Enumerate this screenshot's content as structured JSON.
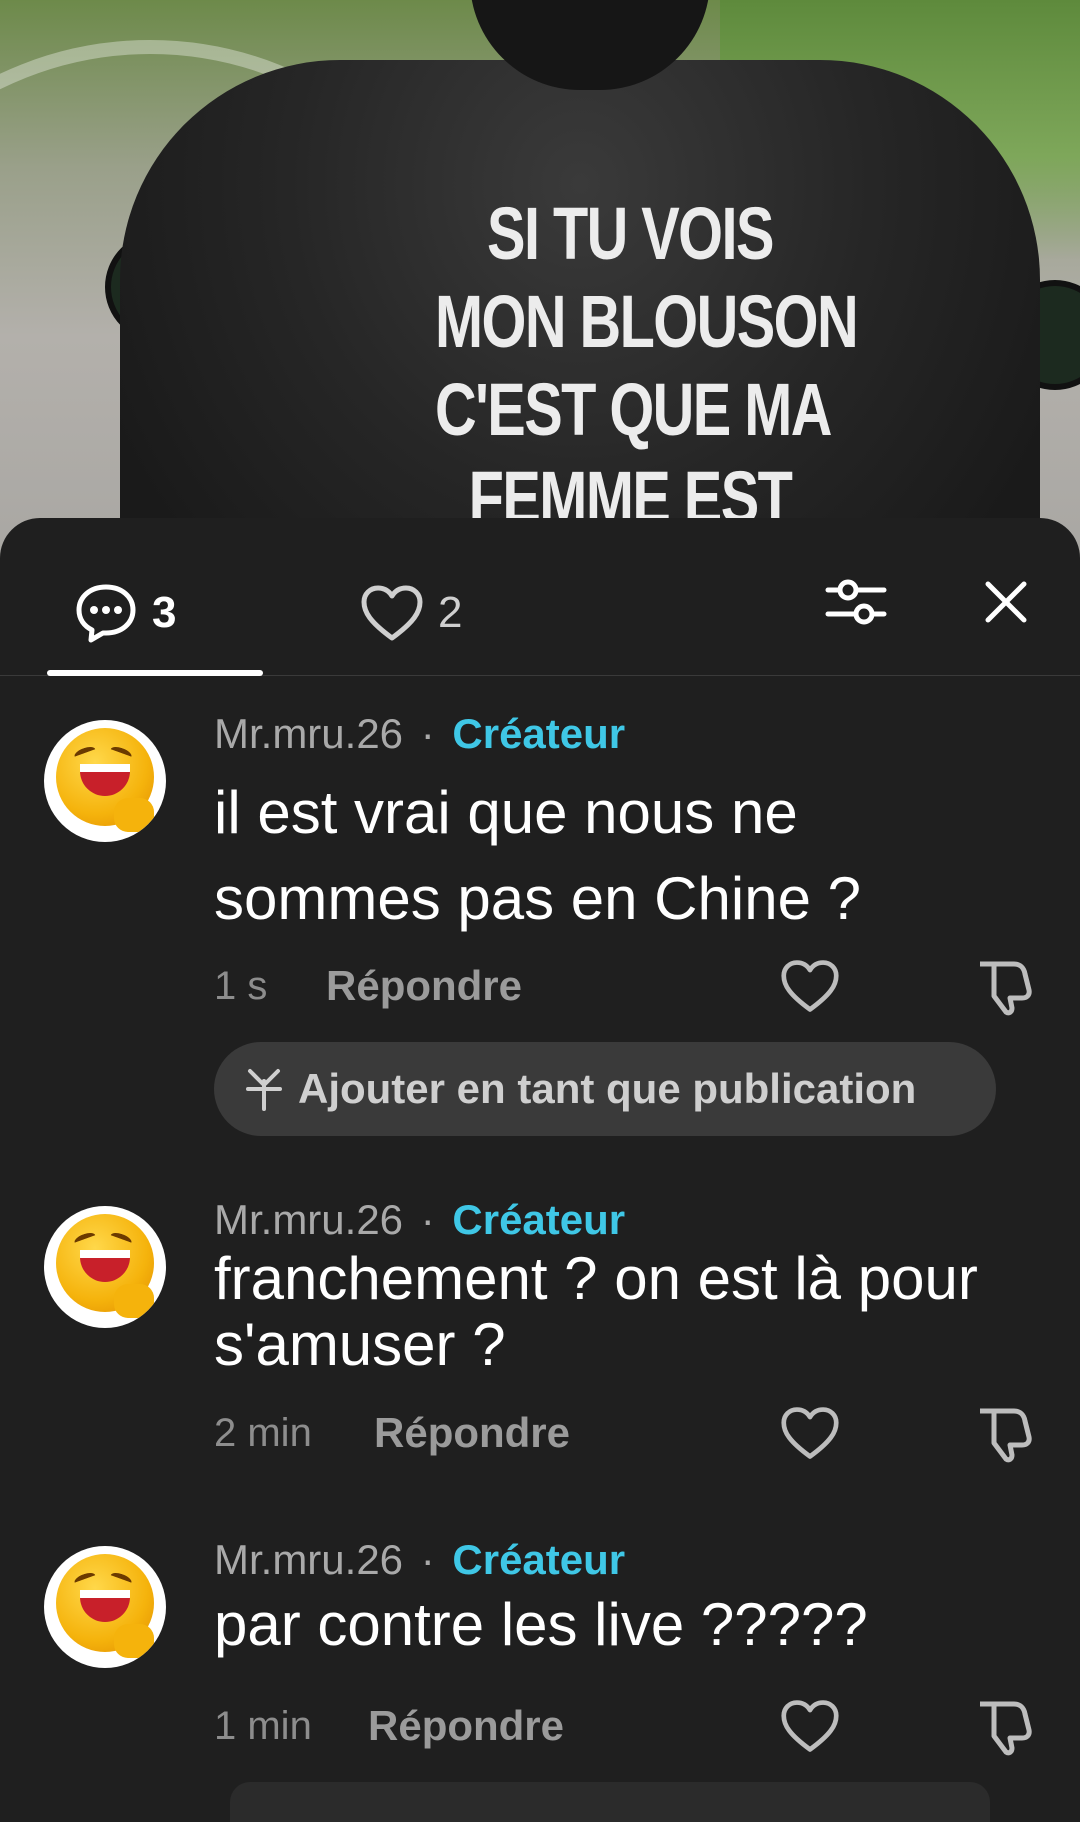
{
  "photo": {
    "slogan_lines": [
      "SI TU VOIS",
      "MON BLOUSON",
      "C'EST QUE MA",
      "FEMME EST"
    ]
  },
  "tabs": {
    "comments_count": "3",
    "likes_count": "2"
  },
  "comments": [
    {
      "author": "Mr.mru.26",
      "separator": "·",
      "badge": "Créateur",
      "text": "il est vrai que nous ne sommes pas en Chine ?",
      "time": "1 s",
      "reply_label": "Répondre"
    },
    {
      "author": "Mr.mru.26",
      "separator": "·",
      "badge": "Créateur",
      "text": "franchement ? on est là pour s'amuser ?",
      "time": "2 min",
      "reply_label": "Répondre"
    },
    {
      "author": "Mr.mru.26",
      "separator": "·",
      "badge": "Créateur",
      "text": "par contre les live ?????",
      "time": "1 min",
      "reply_label": "Répondre"
    }
  ],
  "post_chip": {
    "label": "Ajouter en tant que publication"
  },
  "colors": {
    "background": "#1f1f1f",
    "creator_badge": "#3fc7e6",
    "chip_bg": "#3a3a3a"
  },
  "icons": [
    "comment-bubble-icon",
    "heart-icon",
    "filter-sliders-icon",
    "close-icon",
    "dislike-icon",
    "pin-sparkle-icon"
  ]
}
